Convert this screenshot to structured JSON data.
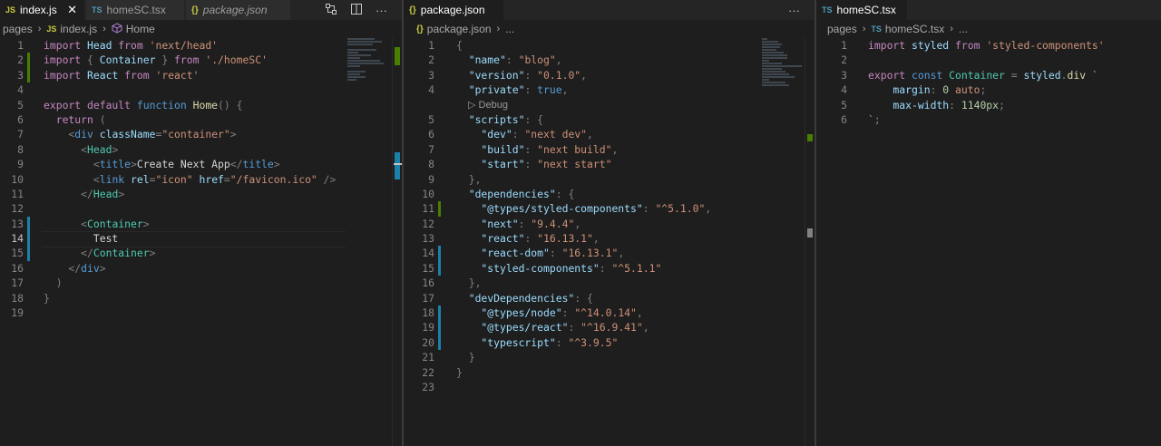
{
  "group1": {
    "tabs": [
      {
        "icon": "JS",
        "label": "index.js",
        "active": true,
        "close": "✕"
      },
      {
        "icon": "TS",
        "label": "homeSC.tsx",
        "active": false
      },
      {
        "icon": "{}",
        "label": "package.json",
        "active": false,
        "italic": true
      }
    ],
    "actions": [
      "compare-icon",
      "split-editor-icon",
      "more-actions-icon"
    ],
    "breadcrumb": [
      "pages",
      "index.js",
      "Home"
    ],
    "lines": [
      {
        "n": "1",
        "t": [
          [
            "kc",
            "import "
          ],
          [
            "vr",
            "Head"
          ],
          [
            "kc",
            " from "
          ],
          [
            "st",
            "'next/head'"
          ]
        ]
      },
      {
        "n": "2",
        "t": [
          [
            "kc",
            "import "
          ],
          [
            "pu",
            "{ "
          ],
          [
            "vr",
            "Container"
          ],
          [
            "pu",
            " } "
          ],
          [
            "kc",
            "from "
          ],
          [
            "st",
            "'./homeSC'"
          ]
        ]
      },
      {
        "n": "3",
        "t": [
          [
            "kc",
            "import "
          ],
          [
            "vr",
            "React"
          ],
          [
            "kc",
            " from "
          ],
          [
            "st",
            "'react'"
          ]
        ]
      },
      {
        "n": "4",
        "t": []
      },
      {
        "n": "5",
        "t": [
          [
            "kc",
            "export default "
          ],
          [
            "kw",
            "function "
          ],
          [
            "fn",
            "Home"
          ],
          [
            "pu",
            "() {"
          ]
        ]
      },
      {
        "n": "6",
        "t": [
          [
            "pu",
            "  "
          ],
          [
            "kc",
            "return "
          ],
          [
            "pu",
            "("
          ]
        ]
      },
      {
        "n": "7",
        "t": [
          [
            "pu",
            "    <"
          ],
          [
            "tg",
            "div "
          ],
          [
            "at",
            "className"
          ],
          [
            "pu",
            "="
          ],
          [
            "st",
            "\"container\""
          ],
          [
            "pu",
            ">"
          ]
        ]
      },
      {
        "n": "8",
        "t": [
          [
            "pu",
            "      <"
          ],
          [
            "ty",
            "Head"
          ],
          [
            "pu",
            ">"
          ]
        ]
      },
      {
        "n": "9",
        "t": [
          [
            "pu",
            "        <"
          ],
          [
            "tg",
            "title"
          ],
          [
            "pu",
            ">"
          ],
          [
            "",
            "Create Next App"
          ],
          [
            "pu",
            "</"
          ],
          [
            "tg",
            "title"
          ],
          [
            "pu",
            ">"
          ]
        ]
      },
      {
        "n": "10",
        "t": [
          [
            "pu",
            "        <"
          ],
          [
            "tg",
            "link "
          ],
          [
            "at",
            "rel"
          ],
          [
            "pu",
            "="
          ],
          [
            "st",
            "\"icon\" "
          ],
          [
            "at",
            "href"
          ],
          [
            "pu",
            "="
          ],
          [
            "st",
            "\"/favicon.ico\""
          ],
          [
            "pu",
            " />"
          ]
        ]
      },
      {
        "n": "11",
        "t": [
          [
            "pu",
            "      </"
          ],
          [
            "ty",
            "Head"
          ],
          [
            "pu",
            ">"
          ]
        ]
      },
      {
        "n": "12",
        "t": []
      },
      {
        "n": "13",
        "t": [
          [
            "pu",
            "      <"
          ],
          [
            "ty",
            "Container"
          ],
          [
            "pu",
            ">"
          ]
        ]
      },
      {
        "n": "14",
        "t": [
          [
            "",
            "        Test"
          ]
        ]
      },
      {
        "n": "15",
        "t": [
          [
            "pu",
            "      </"
          ],
          [
            "ty",
            "Container"
          ],
          [
            "pu",
            ">"
          ]
        ]
      },
      {
        "n": "16",
        "t": [
          [
            "pu",
            "    </"
          ],
          [
            "tg",
            "div"
          ],
          [
            "pu",
            ">"
          ]
        ]
      },
      {
        "n": "17",
        "t": [
          [
            "pu",
            "  )"
          ]
        ]
      },
      {
        "n": "18",
        "t": [
          [
            "pu",
            "}"
          ]
        ]
      },
      {
        "n": "19",
        "t": []
      }
    ]
  },
  "group2": {
    "tabs": [
      {
        "icon": "{}",
        "label": "package.json",
        "active": true
      }
    ],
    "actions": [
      "more-actions-icon"
    ],
    "breadcrumb": [
      "package.json",
      "..."
    ],
    "codelens": "Debug",
    "lines": [
      {
        "n": "1",
        "t": [
          [
            "pu",
            "{"
          ]
        ]
      },
      {
        "n": "2",
        "t": [
          [
            "vr",
            "  \"name\""
          ],
          [
            "pu",
            ": "
          ],
          [
            "st",
            "\"blog\""
          ],
          [
            "pu",
            ","
          ]
        ]
      },
      {
        "n": "3",
        "t": [
          [
            "vr",
            "  \"version\""
          ],
          [
            "pu",
            ": "
          ],
          [
            "st",
            "\"0.1.0\""
          ],
          [
            "pu",
            ","
          ]
        ]
      },
      {
        "n": "4",
        "t": [
          [
            "vr",
            "  \"private\""
          ],
          [
            "pu",
            ": "
          ],
          [
            "kw",
            "true"
          ],
          [
            "pu",
            ","
          ]
        ]
      },
      {
        "n": "5",
        "t": [
          [
            "vr",
            "  \"scripts\""
          ],
          [
            "pu",
            ": {"
          ]
        ]
      },
      {
        "n": "6",
        "t": [
          [
            "vr",
            "    \"dev\""
          ],
          [
            "pu",
            ": "
          ],
          [
            "st",
            "\"next dev\""
          ],
          [
            "pu",
            ","
          ]
        ]
      },
      {
        "n": "7",
        "t": [
          [
            "vr",
            "    \"build\""
          ],
          [
            "pu",
            ": "
          ],
          [
            "st",
            "\"next build\""
          ],
          [
            "pu",
            ","
          ]
        ]
      },
      {
        "n": "8",
        "t": [
          [
            "vr",
            "    \"start\""
          ],
          [
            "pu",
            ": "
          ],
          [
            "st",
            "\"next start\""
          ]
        ]
      },
      {
        "n": "9",
        "t": [
          [
            "pu",
            "  },"
          ]
        ]
      },
      {
        "n": "10",
        "t": [
          [
            "vr",
            "  \"dependencies\""
          ],
          [
            "pu",
            ": {"
          ]
        ]
      },
      {
        "n": "11",
        "t": [
          [
            "vr",
            "    \"@types/styled-components\""
          ],
          [
            "pu",
            ": "
          ],
          [
            "st",
            "\"^5.1.0\""
          ],
          [
            "pu",
            ","
          ]
        ]
      },
      {
        "n": "12",
        "t": [
          [
            "vr",
            "    \"next\""
          ],
          [
            "pu",
            ": "
          ],
          [
            "st",
            "\"9.4.4\""
          ],
          [
            "pu",
            ","
          ]
        ]
      },
      {
        "n": "13",
        "t": [
          [
            "vr",
            "    \"react\""
          ],
          [
            "pu",
            ": "
          ],
          [
            "st",
            "\"16.13.1\""
          ],
          [
            "pu",
            ","
          ]
        ]
      },
      {
        "n": "14",
        "t": [
          [
            "vr",
            "    \"react-dom\""
          ],
          [
            "pu",
            ": "
          ],
          [
            "st",
            "\"16.13.1\""
          ],
          [
            "pu",
            ","
          ]
        ]
      },
      {
        "n": "15",
        "t": [
          [
            "vr",
            "    \"styled-components\""
          ],
          [
            "pu",
            ": "
          ],
          [
            "st",
            "\"^5.1.1\""
          ]
        ]
      },
      {
        "n": "16",
        "t": [
          [
            "pu",
            "  },"
          ]
        ]
      },
      {
        "n": "17",
        "t": [
          [
            "vr",
            "  \"devDependencies\""
          ],
          [
            "pu",
            ": {"
          ]
        ]
      },
      {
        "n": "18",
        "t": [
          [
            "vr",
            "    \"@types/node\""
          ],
          [
            "pu",
            ": "
          ],
          [
            "st",
            "\"^14.0.14\""
          ],
          [
            "pu",
            ","
          ]
        ]
      },
      {
        "n": "19",
        "t": [
          [
            "vr",
            "    \"@types/react\""
          ],
          [
            "pu",
            ": "
          ],
          [
            "st",
            "\"^16.9.41\""
          ],
          [
            "pu",
            ","
          ]
        ]
      },
      {
        "n": "20",
        "t": [
          [
            "vr",
            "    \"typescript\""
          ],
          [
            "pu",
            ": "
          ],
          [
            "st",
            "\"^3.9.5\""
          ]
        ]
      },
      {
        "n": "21",
        "t": [
          [
            "pu",
            "  }"
          ]
        ]
      },
      {
        "n": "22",
        "t": [
          [
            "pu",
            "}"
          ]
        ]
      },
      {
        "n": "23",
        "t": []
      }
    ]
  },
  "group3": {
    "tabs": [
      {
        "icon": "TS",
        "label": "homeSC.tsx",
        "active": true
      }
    ],
    "breadcrumb": [
      "pages",
      "homeSC.tsx",
      "..."
    ],
    "lines": [
      {
        "n": "1",
        "t": [
          [
            "kc",
            "import "
          ],
          [
            "vr",
            "styled"
          ],
          [
            "kc",
            " from "
          ],
          [
            "st",
            "'styled-components'"
          ]
        ]
      },
      {
        "n": "2",
        "t": []
      },
      {
        "n": "3",
        "t": [
          [
            "kc",
            "export "
          ],
          [
            "kw",
            "const "
          ],
          [
            "ty",
            "Container"
          ],
          [
            "pu",
            " = "
          ],
          [
            "vr",
            "styled"
          ],
          [
            "pu",
            "."
          ],
          [
            "fn",
            "div"
          ],
          [
            "st",
            " `"
          ]
        ]
      },
      {
        "n": "4",
        "t": [
          [
            "vr",
            "    margin"
          ],
          [
            "pu",
            ": "
          ],
          [
            "nm",
            "0 "
          ],
          [
            "st",
            "auto"
          ],
          [
            "pu",
            ";"
          ]
        ]
      },
      {
        "n": "5",
        "t": [
          [
            "vr",
            "    max-width"
          ],
          [
            "pu",
            ": "
          ],
          [
            "nm",
            "1140px"
          ],
          [
            "pu",
            ";"
          ]
        ]
      },
      {
        "n": "6",
        "t": [
          [
            "st",
            "`"
          ],
          [
            "pu",
            ";"
          ]
        ]
      }
    ]
  }
}
